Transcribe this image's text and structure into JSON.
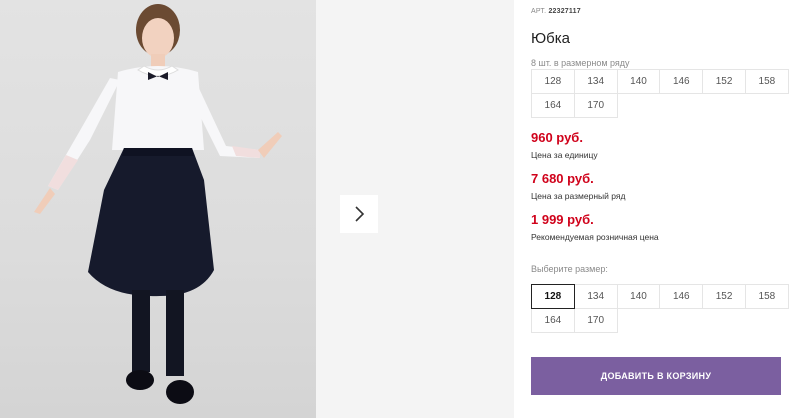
{
  "product": {
    "art_label": "АРТ.",
    "art_number": "22327117",
    "title": "Юбка",
    "pack_hint": "8 шт. в размерном ряду"
  },
  "pack_sizes": [
    "128",
    "134",
    "140",
    "146",
    "152",
    "158",
    "164",
    "170"
  ],
  "prices": [
    {
      "value": "960 руб.",
      "label": "Цена за единицу"
    },
    {
      "value": "7 680 руб.",
      "label": "Цена за размерный ряд"
    },
    {
      "value": "1 999 руб.",
      "label": "Рекомендуемая розничная цена"
    }
  ],
  "size_picker": {
    "label": "Выберите размер:",
    "sizes": [
      "128",
      "134",
      "140",
      "146",
      "152",
      "158",
      "164",
      "170"
    ],
    "selected": "128"
  },
  "add_to_cart_label": "ДОБАВИТЬ В КОРЗИНУ",
  "colors": {
    "price": "#d0021b",
    "button": "#7b5fa0"
  },
  "icons": {
    "next": "chevron-right-icon"
  }
}
